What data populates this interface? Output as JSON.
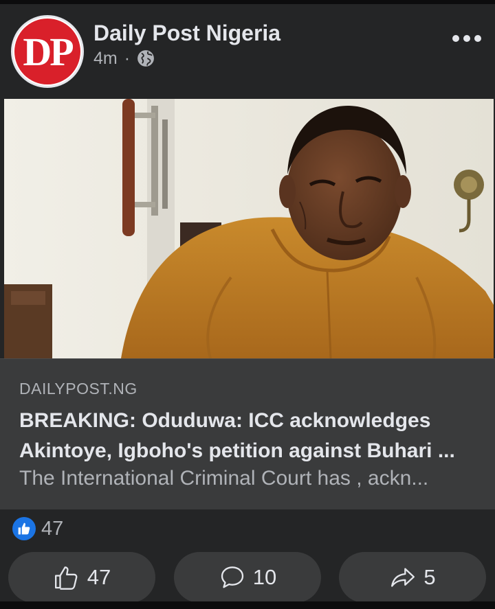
{
  "post": {
    "page_name": "Daily Post Nigeria",
    "avatar_text": "DP",
    "time_ago": "4m",
    "separator": "·",
    "audience_icon": "globe-icon",
    "menu_icon": "more-icon"
  },
  "photo": {
    "subject": "man-in-orange-outfit-photo"
  },
  "link": {
    "domain": "DAILYPOST.NG",
    "headline": "BREAKING: Oduduwa: ICC acknowledges Akintoye, Igboho's petition against Buhari ...",
    "snippet": "The International Criminal Court has , ackn..."
  },
  "reactions": {
    "icon": "like-badge-icon",
    "count": "47"
  },
  "actions": {
    "like": {
      "icon": "thumbs-up-icon",
      "label": "47"
    },
    "comment": {
      "icon": "comment-icon",
      "label": "10"
    },
    "share": {
      "icon": "share-icon",
      "label": "5"
    }
  },
  "colors": {
    "background": "#242526",
    "preview_bg": "#3a3b3c",
    "text_primary": "#e4e6eb",
    "text_secondary": "#b0b3b8",
    "brand_red": "#d9202a",
    "like_blue": "#1b74e4"
  }
}
